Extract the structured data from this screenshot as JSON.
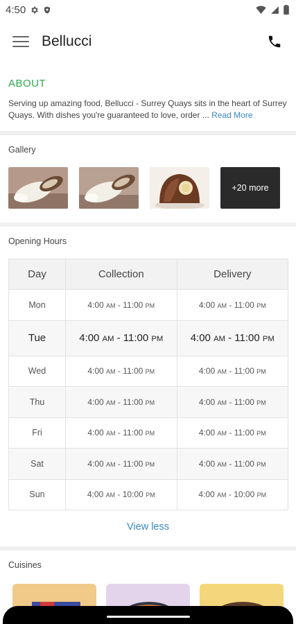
{
  "status_bar": {
    "time": "4:50"
  },
  "app_bar": {
    "title": "Bellucci"
  },
  "about": {
    "heading": "ABOUT",
    "text": "Serving up amazing food, Bellucci - Surrey Quays sits in the heart of Surrey Quays. With dishes you're guaranteed to love, order ...",
    "read_more": "Read More"
  },
  "gallery": {
    "title": "Gallery",
    "more_label": "+20 more"
  },
  "opening_hours": {
    "title": "Opening Hours",
    "headers": [
      "Day",
      "Collection",
      "Delivery"
    ],
    "rows": [
      {
        "day": "Mon",
        "collection": {
          "open": "4:00",
          "open_ampm": "AM",
          "close": "11:00",
          "close_ampm": "PM"
        },
        "delivery": {
          "open": "4:00",
          "open_ampm": "AM",
          "close": "11:00",
          "close_ampm": "PM"
        }
      },
      {
        "day": "Tue",
        "collection": {
          "open": "4:00",
          "open_ampm": "AM",
          "close": "11:00",
          "close_ampm": "PM"
        },
        "delivery": {
          "open": "4:00",
          "open_ampm": "AM",
          "close": "11:00",
          "close_ampm": "PM"
        }
      },
      {
        "day": "Wed",
        "collection": {
          "open": "4:00",
          "open_ampm": "AM",
          "close": "11:00",
          "close_ampm": "PM"
        },
        "delivery": {
          "open": "4:00",
          "open_ampm": "AM",
          "close": "11:00",
          "close_ampm": "PM"
        }
      },
      {
        "day": "Thu",
        "collection": {
          "open": "4:00",
          "open_ampm": "AM",
          "close": "11:00",
          "close_ampm": "PM"
        },
        "delivery": {
          "open": "4:00",
          "open_ampm": "AM",
          "close": "11:00",
          "close_ampm": "PM"
        }
      },
      {
        "day": "Fri",
        "collection": {
          "open": "4:00",
          "open_ampm": "AM",
          "close": "11:00",
          "close_ampm": "PM"
        },
        "delivery": {
          "open": "4:00",
          "open_ampm": "AM",
          "close": "11:00",
          "close_ampm": "PM"
        }
      },
      {
        "day": "Sat",
        "collection": {
          "open": "4:00",
          "open_ampm": "AM",
          "close": "11:00",
          "close_ampm": "PM"
        },
        "delivery": {
          "open": "4:00",
          "open_ampm": "AM",
          "close": "11:00",
          "close_ampm": "PM"
        }
      },
      {
        "day": "Sun",
        "collection": {
          "open": "4:00",
          "open_ampm": "AM",
          "close": "10:00",
          "close_ampm": "PM"
        },
        "delivery": {
          "open": "4:00",
          "open_ampm": "AM",
          "close": "10:00",
          "close_ampm": "PM"
        }
      }
    ],
    "view_less": "View less"
  },
  "cuisines": {
    "title": "Cuisines"
  },
  "colors": {
    "accent_green": "#2fa84f",
    "link_blue": "#3a88c5"
  }
}
